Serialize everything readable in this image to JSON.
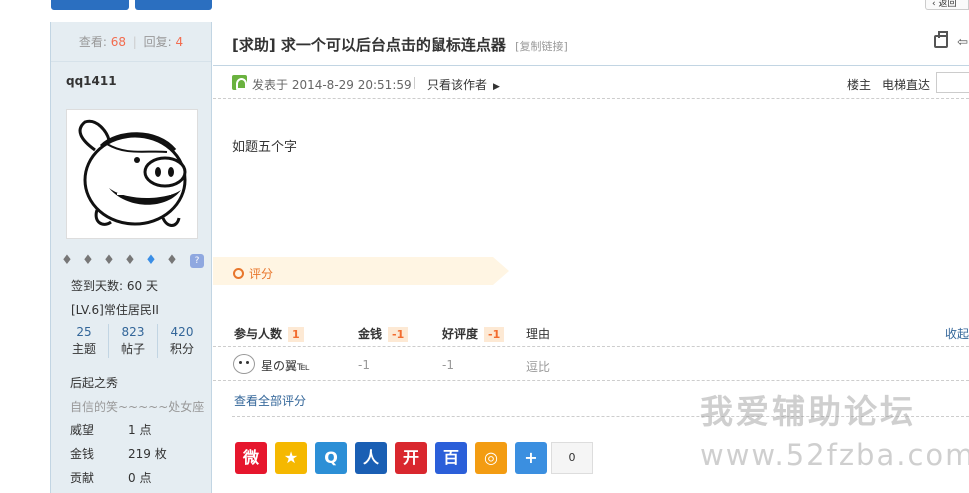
{
  "top": {
    "btn1": "",
    "btn2": "",
    "back": "返回"
  },
  "sidebar": {
    "views_label": "查看:",
    "views": "68",
    "replies_label": "回复:",
    "replies": "4",
    "username": "qq1411",
    "medal_icons": [
      "medal-icon",
      "medal-icon",
      "medal-icon",
      "medal-icon",
      "medal-icon",
      "medal-icon",
      "help-icon"
    ],
    "help_glyph": "?",
    "signin": "签到天数: 60 天",
    "level": "[LV.6]常住居民II",
    "stats": [
      {
        "value": "25",
        "label": "主题"
      },
      {
        "value": "823",
        "label": "帖子"
      },
      {
        "value": "420",
        "label": "积分"
      }
    ],
    "group": "后起之秀",
    "signature": "自信的笑~~~~~处女座",
    "credits": [
      {
        "label": "威望",
        "value": "1 点"
      },
      {
        "label": "金钱",
        "value": "219 枚"
      },
      {
        "label": "贡献",
        "value": "0 点"
      }
    ]
  },
  "post": {
    "title": "[求助] 求一个可以后台点击的鼠标连点器",
    "copy_link": "[复制链接]",
    "posted": "发表于 2014-8-29 20:51:59",
    "only_author": "只看该作者",
    "floor": "楼主",
    "jump_label": "电梯直达",
    "content": "如题五个字"
  },
  "rating": {
    "label": "评分",
    "headers": {
      "participants": "参与人数",
      "participants_count": "1",
      "money": "金钱",
      "money_total": "-1",
      "rep": "好评度",
      "rep_total": "-1",
      "reason": "理由",
      "collapse": "收起"
    },
    "rows": [
      {
        "user": "星の翼℡",
        "money": "-1",
        "rep": "-1",
        "reason": "逗比"
      }
    ],
    "view_all": "查看全部评分"
  },
  "share": {
    "items": [
      {
        "name": "weibo-share-icon",
        "color": "#e6162d",
        "glyph": "微"
      },
      {
        "name": "qzone-share-icon",
        "color": "#f5b800",
        "glyph": "★"
      },
      {
        "name": "tencent-weibo-share-icon",
        "color": "#2c8fd6",
        "glyph": "Q"
      },
      {
        "name": "renren-share-icon",
        "color": "#1a5fb4",
        "glyph": "人"
      },
      {
        "name": "kaixin-share-icon",
        "color": "#d9272e",
        "glyph": "开"
      },
      {
        "name": "baidu-share-icon",
        "color": "#2b5fd9",
        "glyph": "百"
      },
      {
        "name": "douban-share-icon",
        "color": "#f39c12",
        "glyph": "◎"
      },
      {
        "name": "more-share-icon",
        "color": "#3b8fe0",
        "glyph": "+"
      }
    ],
    "count": "0"
  },
  "watermark": {
    "line1": "我爱辅助论坛",
    "line2": "www.52fzba.com"
  }
}
